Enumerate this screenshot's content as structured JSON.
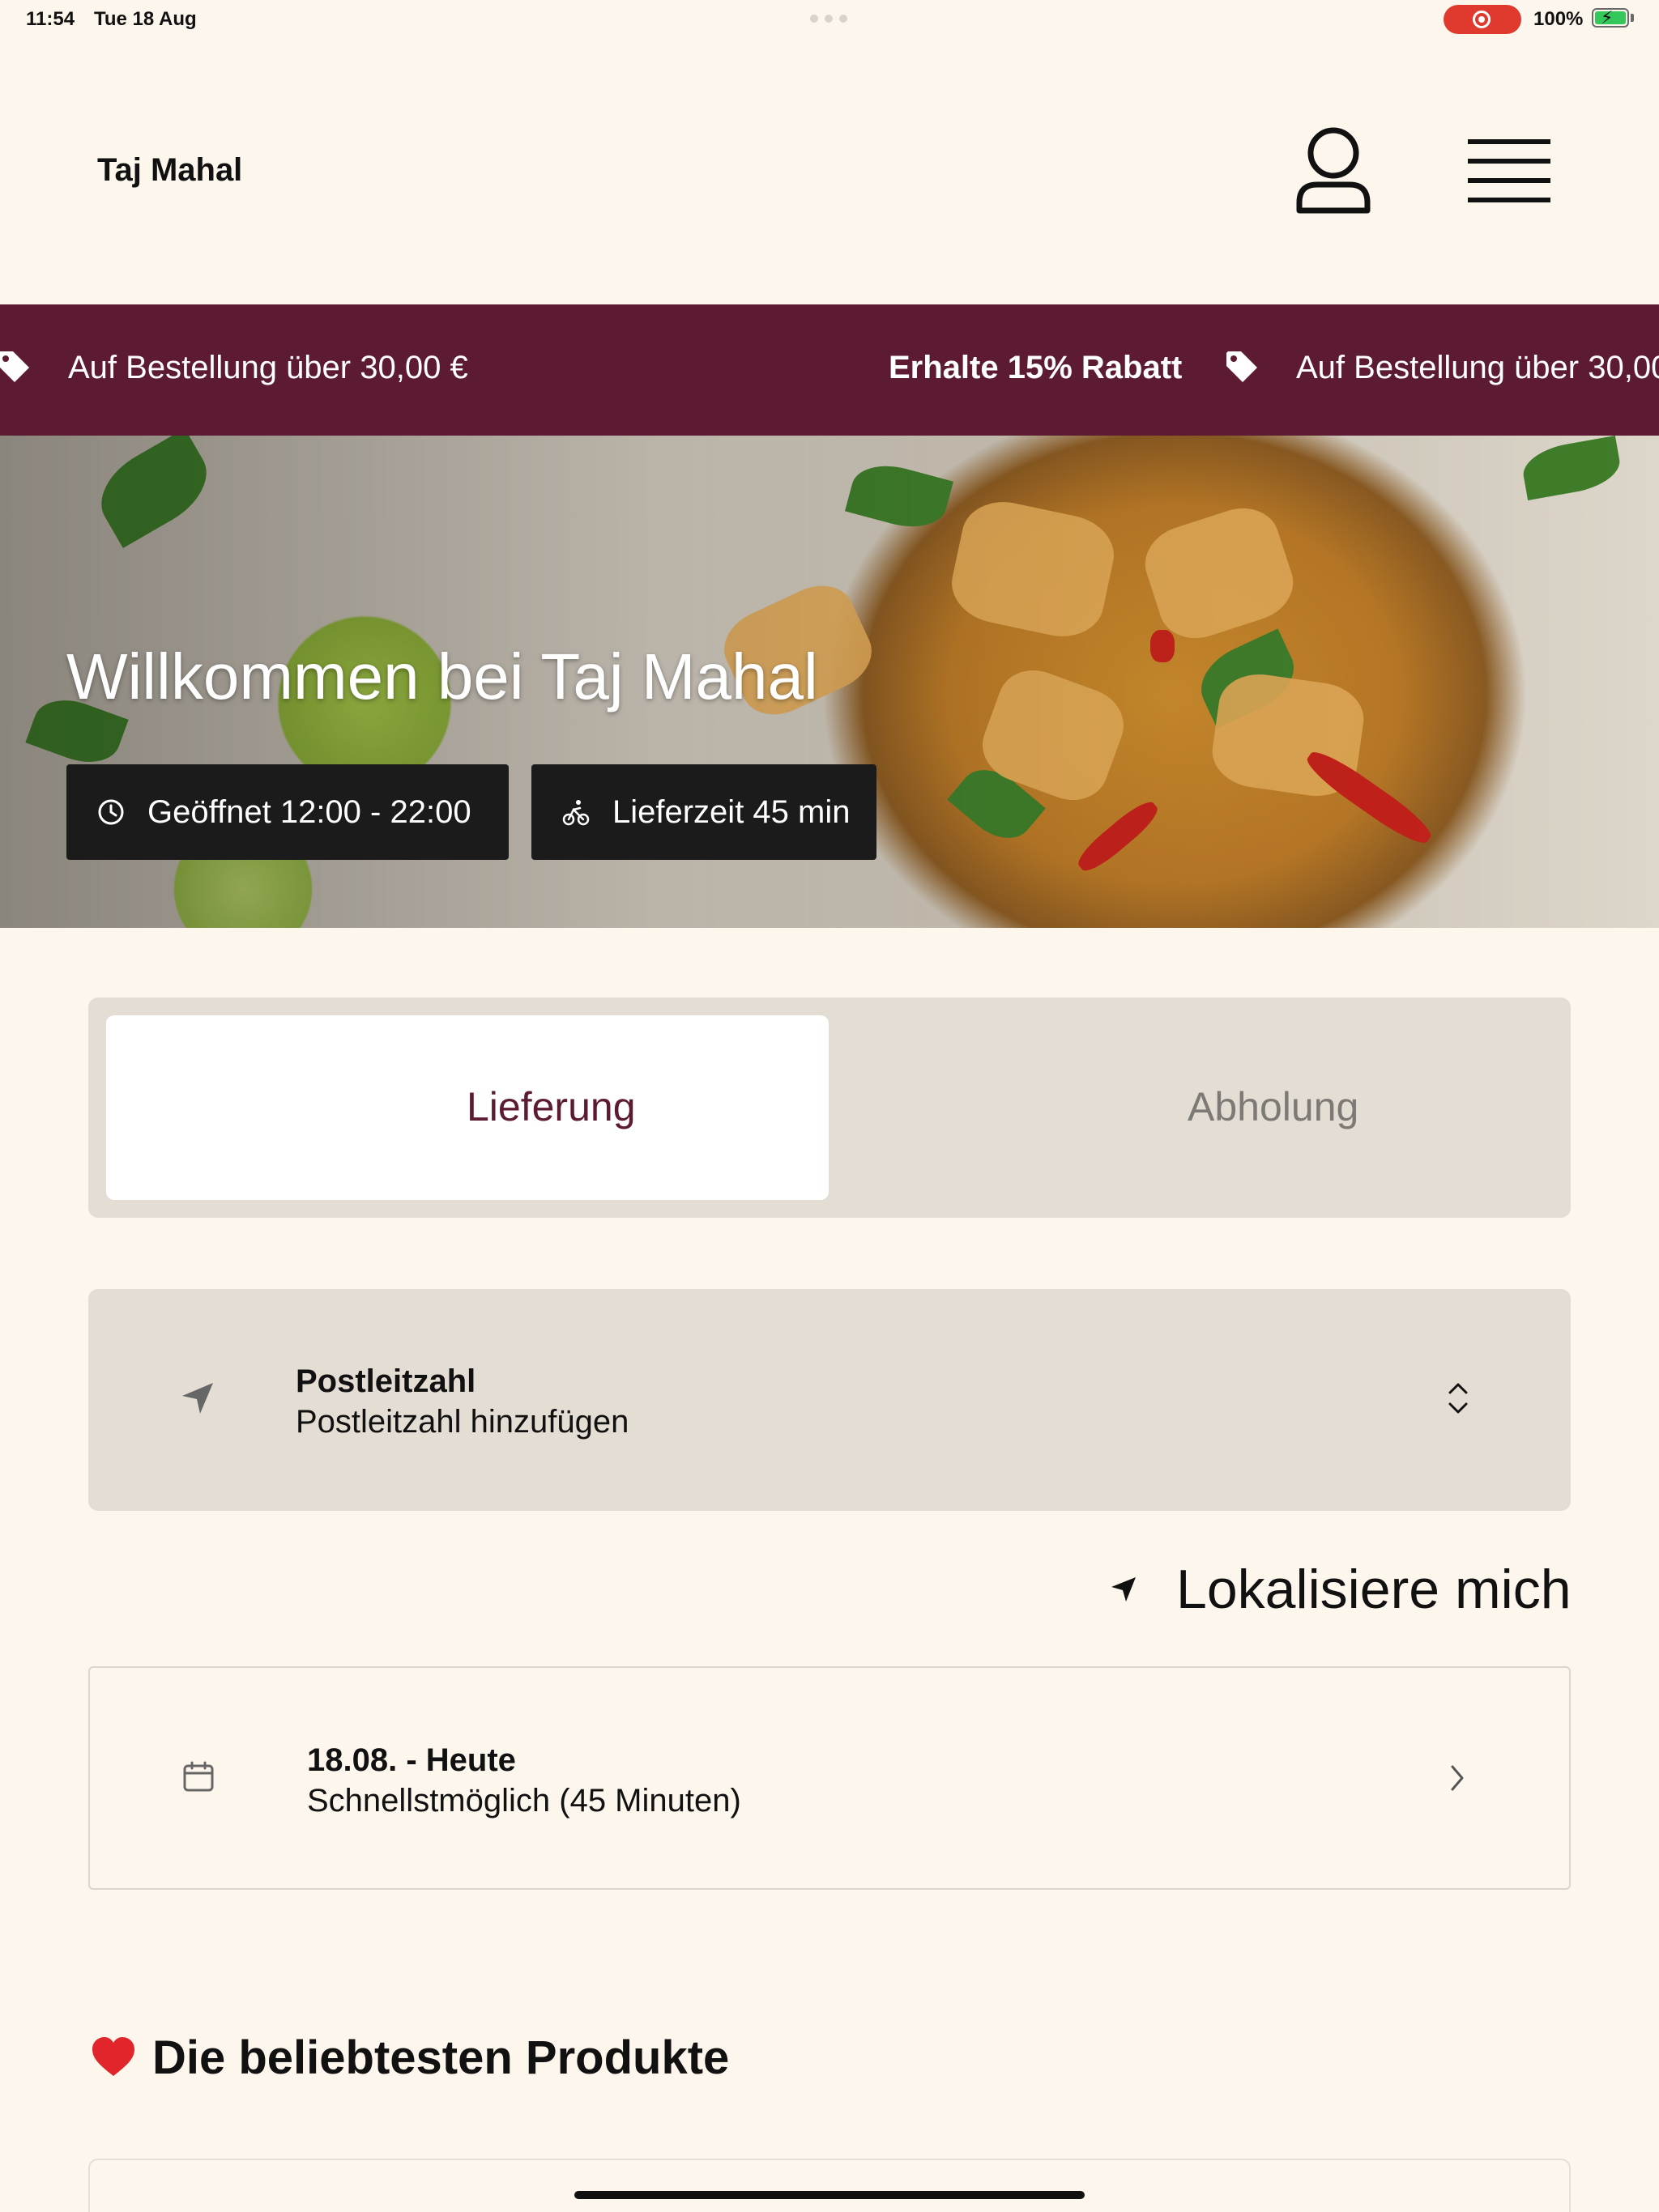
{
  "status_bar": {
    "time": "11:54",
    "date": "Tue 18 Aug",
    "battery": "100%"
  },
  "header": {
    "brand": "Taj Mahal",
    "account_icon": "user-icon",
    "menu_icon": "hamburger-menu-icon"
  },
  "banner": {
    "items": [
      {
        "text": "Auf Bestellung über 30,00 €",
        "bold": false
      },
      {
        "text": "Erhalte 15% Rabatt",
        "bold": true
      },
      {
        "text": "Auf Bestellung über 30,00",
        "bold": false
      }
    ],
    "icon": "tag-icon",
    "color": "#5c1a33"
  },
  "hero": {
    "title": "Willkommen bei Taj Mahal",
    "opening_hours": "Geöffnet 12:00 - 22:00",
    "delivery_time": "Lieferzeit 45 min",
    "clock_icon": "clock-icon",
    "bike_icon": "bike-icon"
  },
  "order_mode": {
    "tabs": [
      {
        "label": "Lieferung",
        "active": true
      },
      {
        "label": "Abholung",
        "active": false
      }
    ]
  },
  "postal": {
    "title": "Postleitzahl",
    "placeholder": "Postleitzahl hinzufügen",
    "icon": "location-arrow-icon"
  },
  "locate": {
    "label": "Lokalisiere mich",
    "icon": "navigation-arrow-icon"
  },
  "delivery_slot": {
    "title": "18.08. - Heute",
    "subtitle": "Schnellstmöglich (45 Minuten)",
    "icon": "calendar-icon"
  },
  "popular": {
    "title": "Die beliebtesten Produkte",
    "icon": "heart-icon"
  },
  "colors": {
    "background": "#fdf6ec",
    "accent": "#5c1a33",
    "panel": "#e4ddd3",
    "chip": "#1b1b1b"
  }
}
